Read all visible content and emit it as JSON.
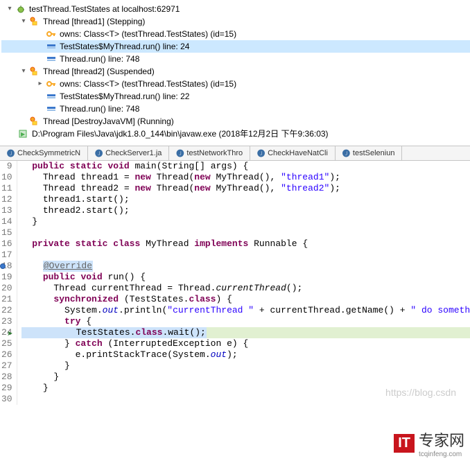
{
  "debug": {
    "root": {
      "label": "testThread.TestStates at localhost:62971"
    },
    "thread1": {
      "label": "Thread [thread1] (Stepping)",
      "owns": "owns: Class<T> (testThread.TestStates) (id=15)",
      "frame1": "TestStates$MyThread.run() line: 24",
      "frame2": "Thread.run() line: 748"
    },
    "thread2": {
      "label": "Thread [thread2] (Suspended)",
      "owns": "owns: Class<T> (testThread.TestStates) (id=15)",
      "frame1": "TestStates$MyThread.run() line: 22",
      "frame2": "Thread.run() line: 748"
    },
    "destroyVm": {
      "label": "Thread [DestroyJavaVM] (Running)"
    },
    "process": {
      "label": "D:\\Program Files\\Java\\jdk1.8.0_144\\bin\\javaw.exe (2018年12月2日 下午9:36:03)"
    }
  },
  "tabs": {
    "t1": "CheckSymmetricN",
    "t2": "CheckServer1.ja",
    "t3": "testNetworkThro",
    "t4": "CheckHaveNatCli",
    "t5": "testSeleniun"
  },
  "lines": {
    "l9": "9",
    "l10": "10",
    "l11": "11",
    "l12": "12",
    "l13": "13",
    "l14": "14",
    "l15": "15",
    "l16": "16",
    "l17": "17",
    "l18": "18",
    "l19": "19",
    "l20": "20",
    "l21": "21",
    "l22": "22",
    "l23": "23",
    "l24": "24",
    "l25": "25",
    "l26": "26",
    "l27": "27",
    "l28": "28",
    "l29": "29",
    "l30": "30"
  },
  "code": {
    "kw_public": "public",
    "kw_static": "static",
    "kw_void": "void",
    "kw_new": "new",
    "kw_private": "private",
    "kw_class": "class",
    "kw_implements": "implements",
    "kw_synchronized": "synchronized",
    "kw_try": "try",
    "kw_catch": "catch",
    "main_sig": " main(String[] args) {",
    "l10a": "    Thread thread1 = ",
    "l10b": " Thread(",
    "l10c": " MyThread(), ",
    "s_t1": "\"thread1\"",
    "l10d": ");",
    "l11a": "    Thread thread2 = ",
    "l11b": " Thread(",
    "l11c": " MyThread(), ",
    "s_t2": "\"thread2\"",
    "l11d": ");",
    "l12": "    thread1.start();",
    "l13": "    thread2.start();",
    "l14": "  }",
    "l16a": " MyThread ",
    "l16b": " Runnable {",
    "override": "@Override",
    "l19a": " run() {",
    "l20a": "      Thread currentThread = Thread.",
    "l20_cur": "currentThread",
    "l20b": "();",
    "l21a": " (TestStates.",
    "l21_cls": "class",
    "l21b": ") {",
    "l22a": "        System.",
    "fld_out": "out",
    "l22b": ".println(",
    "s_msg1": "\"currentThread \"",
    "l22c": " + currentThread.getName() + ",
    "s_msg2": "\" do something!!\"",
    "l22d": ");",
    "l23a": " {",
    "l24a": "          TestStates.",
    "l24_cls": "class",
    "l24b": ".wait();",
    "l25a": "        } ",
    "l25b": " (InterruptedException e) {",
    "l26a": "          e.printStackTrace(System.",
    "l26b": ");",
    "l27": "        }",
    "l28": "      }",
    "l29": "    }"
  },
  "watermark": "https://blog.csdn",
  "logo": {
    "it": "IT",
    "name": "专家网",
    "sub": "tcqinfeng.com"
  }
}
